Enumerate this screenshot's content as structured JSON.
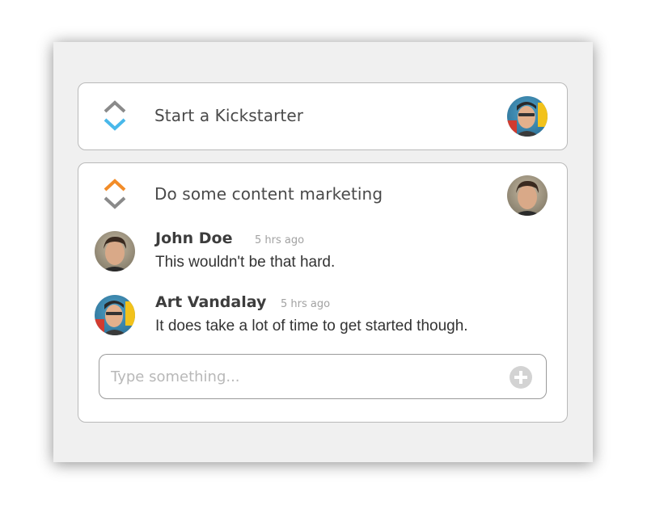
{
  "colors": {
    "upvote_active": "#f28c28",
    "downvote_active": "#49b8ea",
    "vote_inactive": "#8a8a8a",
    "panel_bg": "#f0f0f0",
    "card_border": "#b9b9b9"
  },
  "tasks": [
    {
      "title": "Start a Kickstarter",
      "vote_state": "down",
      "avatar": "user-avatar-art-vandalay",
      "comments": []
    },
    {
      "title": "Do some content marketing",
      "vote_state": "up",
      "avatar": "user-avatar-john-doe",
      "comments": [
        {
          "author": "John Doe",
          "time": "5 hrs ago",
          "text": "This wouldn't be that hard.",
          "avatar": "user-avatar-john-doe"
        },
        {
          "author": "Art Vandalay",
          "time": "5 hrs ago",
          "text": "It does take a lot of time to get started though.",
          "avatar": "user-avatar-art-vandalay"
        }
      ],
      "composer": {
        "placeholder": "Type something...",
        "value": "",
        "add_icon": "plus-circle-icon"
      }
    }
  ]
}
